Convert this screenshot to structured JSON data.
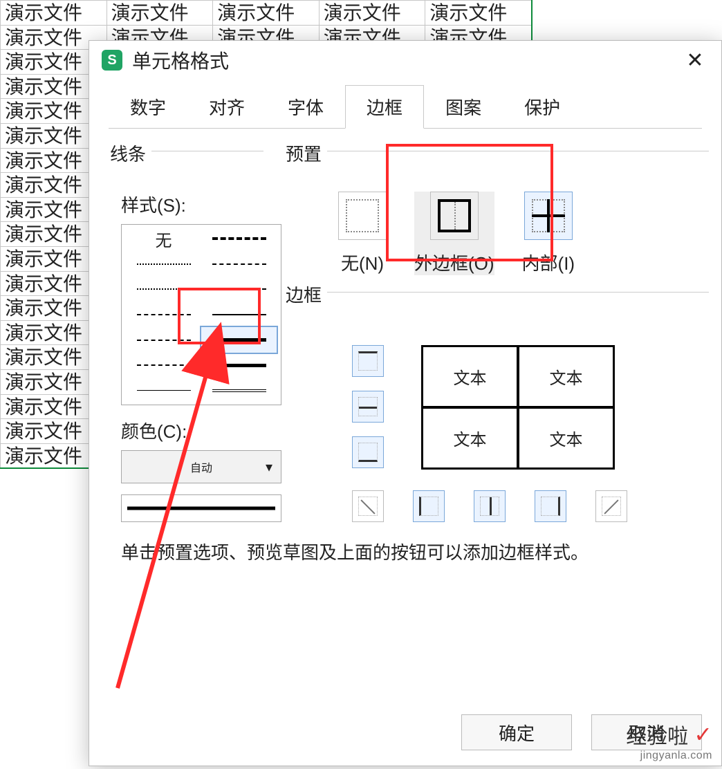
{
  "sheet": {
    "cell_text": "演示文件",
    "rows": 19,
    "cols": 5
  },
  "dialog": {
    "title": "单元格格式",
    "tabs": [
      "数字",
      "对齐",
      "字体",
      "边框",
      "图案",
      "保护"
    ],
    "active_tab_index": 3,
    "line": {
      "section_label": "线条",
      "style_label": "样式(S):",
      "none_label": "无",
      "color_label": "颜色(C):",
      "color_value": "自动"
    },
    "presets": {
      "section_label": "预置",
      "items": [
        {
          "key": "none",
          "label": "无(N)"
        },
        {
          "key": "outer",
          "label": "外边框(O)"
        },
        {
          "key": "inner",
          "label": "内部(I)"
        }
      ]
    },
    "border": {
      "section_label": "边框",
      "sample_text": "文本"
    },
    "hint": "单击预置选项、预览草图及上面的按钮可以添加边框样式。",
    "buttons": {
      "ok": "确定",
      "cancel": "取消"
    }
  },
  "watermark": {
    "line1": "经验啦",
    "line2": "jingyanla.com"
  }
}
